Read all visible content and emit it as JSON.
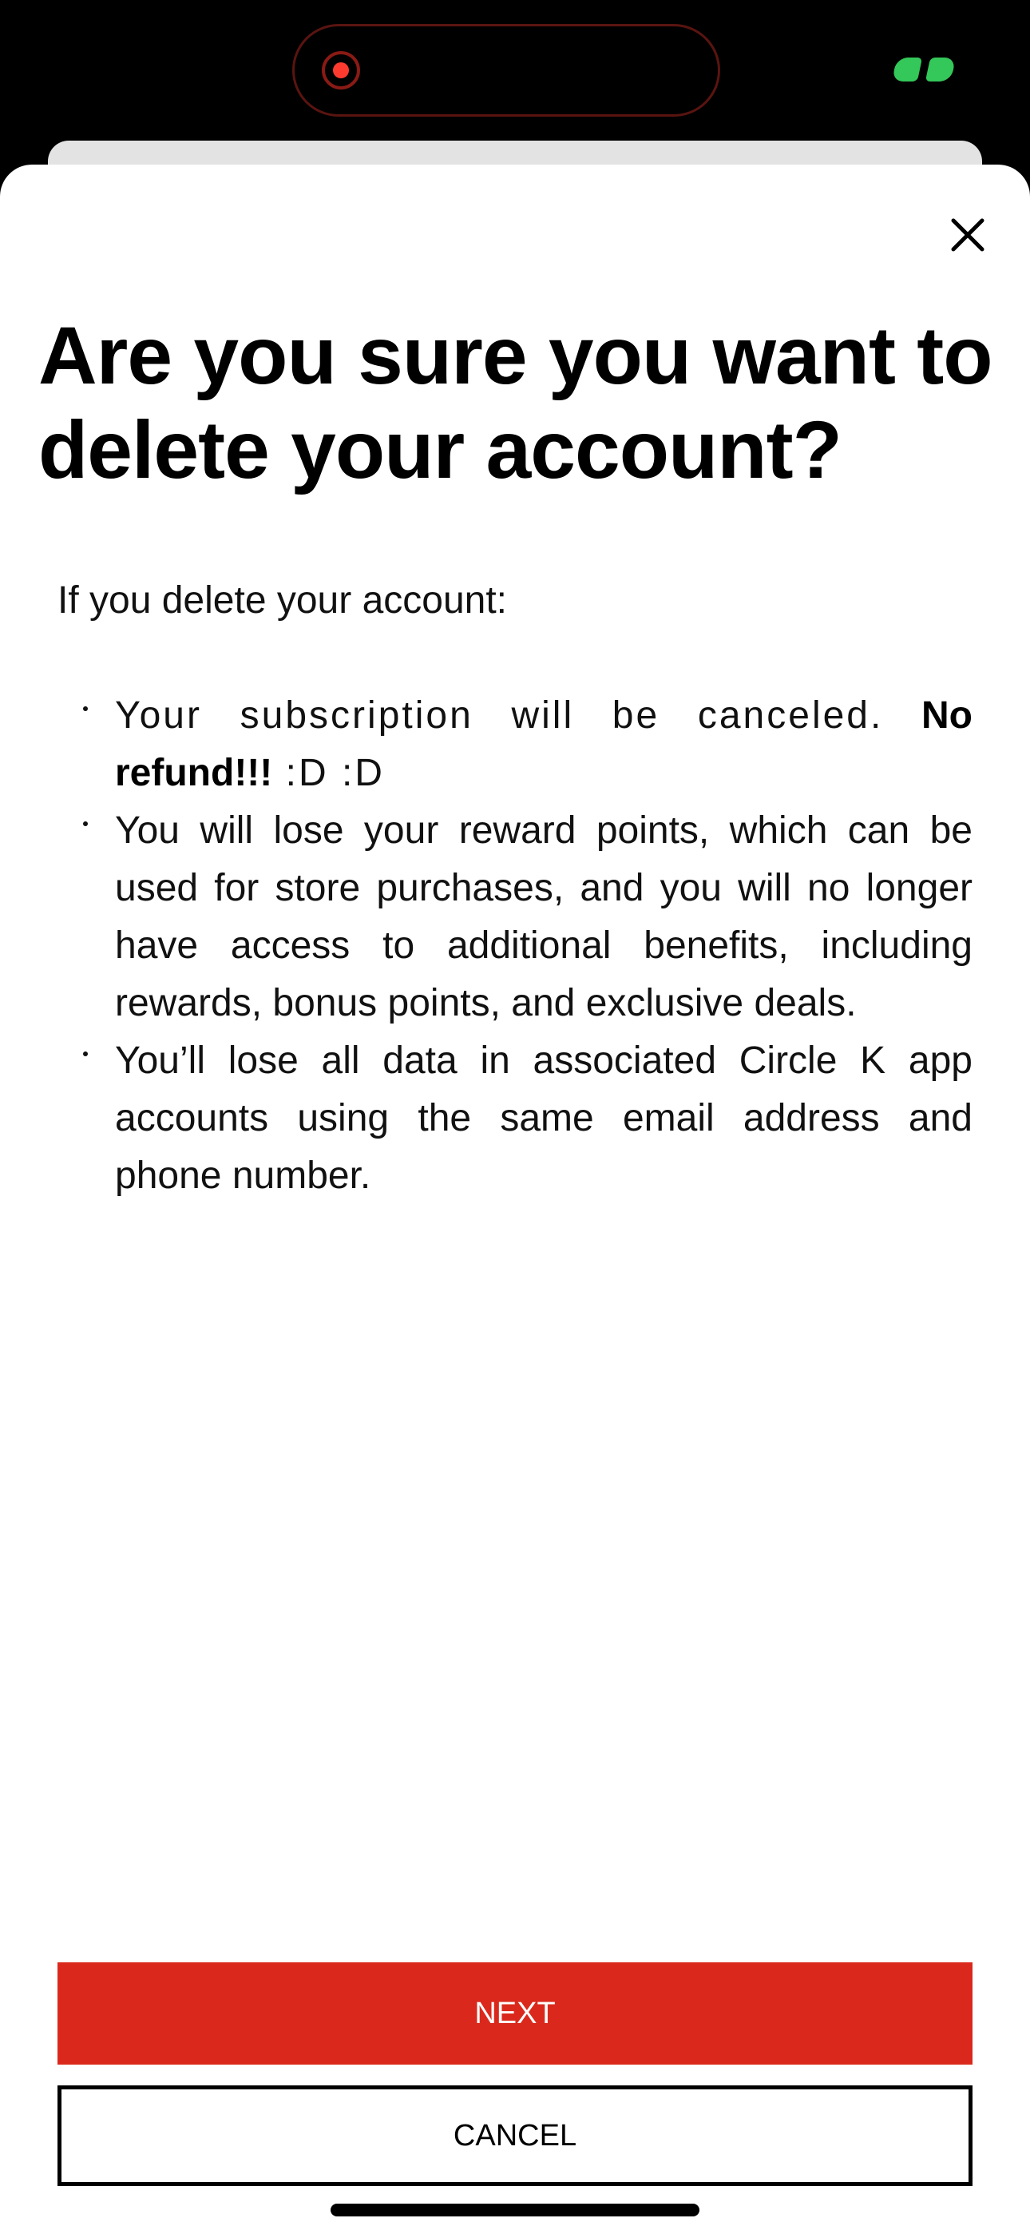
{
  "status_bar": {
    "recording_icon": "recording-dot-icon",
    "call_icon": "active-call-icon",
    "call_color": "#34c759",
    "recording_color": "#ff3b30"
  },
  "dialog": {
    "close_icon": "close-icon",
    "title": "Are you sure you want to delete your account?",
    "intro": "If you delete your account:",
    "bullets": [
      {
        "text_before": "Your subscription will be canceled. ",
        "bold": "No refund!!!",
        "text_after": " :D :D"
      },
      {
        "text": "You will lose your reward points, which can be used for store purchases, and you will no longer have access to additional benefits, including rewards, bonus points, and exclusive deals."
      },
      {
        "text": "You’ll lose all data in associated Circle K app accounts using the same email address and phone number."
      }
    ],
    "next_label": "NEXT",
    "cancel_label": "CANCEL",
    "accent_color": "#da291c"
  }
}
